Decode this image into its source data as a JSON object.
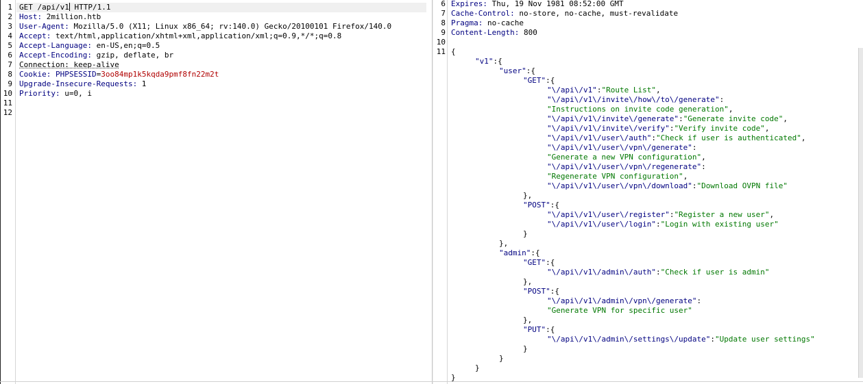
{
  "request": {
    "lines": [
      {
        "n": "1",
        "segs": [
          {
            "t": "GET /api/v1",
            "c": ""
          },
          {
            "t": " HTTP/1.1",
            "c": "",
            "caret_before": true
          }
        ]
      },
      {
        "n": "2",
        "segs": [
          {
            "t": "Host:",
            "c": "k"
          },
          {
            "t": " 2million.htb",
            "c": ""
          }
        ]
      },
      {
        "n": "3",
        "segs": [
          {
            "t": "User-Agent:",
            "c": "k"
          },
          {
            "t": " Mozilla/5.0 (X11; Linux x86_64; rv:140.0) Gecko/20100101 Firefox/140.0",
            "c": ""
          }
        ]
      },
      {
        "n": "4",
        "segs": [
          {
            "t": "Accept:",
            "c": "k"
          },
          {
            "t": " text/html,application/xhtml+xml,application/xml;q=0.9,*/*;q=0.8",
            "c": ""
          }
        ]
      },
      {
        "n": "5",
        "segs": [
          {
            "t": "Accept-Language:",
            "c": "k"
          },
          {
            "t": " en-US,en;q=0.5",
            "c": ""
          }
        ]
      },
      {
        "n": "6",
        "segs": [
          {
            "t": "Accept-Encoding:",
            "c": "k"
          },
          {
            "t": " gzip, deflate, br",
            "c": ""
          }
        ]
      },
      {
        "n": "7",
        "segs": [
          {
            "t": "Connection: keep-alive",
            "c": "underline"
          }
        ]
      },
      {
        "n": "8",
        "segs": [
          {
            "t": "Cookie:",
            "c": "k"
          },
          {
            "t": " PHPSESSID",
            "c": "ck"
          },
          {
            "t": "=",
            "c": ""
          },
          {
            "t": "3oo84mp1k5kqda9pmf8fn22m2t",
            "c": "cv"
          }
        ]
      },
      {
        "n": "9",
        "segs": [
          {
            "t": "Upgrade-Insecure-Requests:",
            "c": "k"
          },
          {
            "t": " 1",
            "c": ""
          }
        ]
      },
      {
        "n": "10",
        "segs": [
          {
            "t": "Priority:",
            "c": "k"
          },
          {
            "t": " u=0, i",
            "c": ""
          }
        ]
      },
      {
        "n": "11",
        "segs": []
      },
      {
        "n": "12",
        "segs": []
      }
    ]
  },
  "response": {
    "lines": [
      {
        "n": "6",
        "segs": [
          {
            "t": "Expires:",
            "c": "k"
          },
          {
            "t": " Thu, 19 Nov 1981 08:52:00 GMT",
            "c": ""
          }
        ]
      },
      {
        "n": "7",
        "segs": [
          {
            "t": "Cache-Control:",
            "c": "k"
          },
          {
            "t": " no-store, no-cache, must-revalidate",
            "c": ""
          }
        ]
      },
      {
        "n": "8",
        "segs": [
          {
            "t": "Pragma:",
            "c": "k"
          },
          {
            "t": " no-cache",
            "c": ""
          }
        ]
      },
      {
        "n": "9",
        "segs": [
          {
            "t": "Content-Length:",
            "c": "k"
          },
          {
            "t": " 800",
            "c": ""
          }
        ]
      },
      {
        "n": "10",
        "segs": []
      },
      {
        "n": "11",
        "segs": [
          {
            "t": "{",
            "c": ""
          }
        ]
      },
      {
        "n": "",
        "indent": 5,
        "segs": [
          {
            "t": "\"v1\"",
            "c": "js"
          },
          {
            "t": ":{",
            "c": ""
          }
        ]
      },
      {
        "n": "",
        "indent": 10,
        "segs": [
          {
            "t": "\"user\"",
            "c": "js"
          },
          {
            "t": ":{",
            "c": ""
          }
        ]
      },
      {
        "n": "",
        "indent": 15,
        "segs": [
          {
            "t": "\"GET\"",
            "c": "js"
          },
          {
            "t": ":{",
            "c": ""
          }
        ]
      },
      {
        "n": "",
        "indent": 20,
        "segs": [
          {
            "t": "\"\\/api\\/v1\"",
            "c": "js"
          },
          {
            "t": ":",
            "c": ""
          },
          {
            "t": "\"Route List\"",
            "c": "jv"
          },
          {
            "t": ",",
            "c": ""
          }
        ]
      },
      {
        "n": "",
        "indent": 20,
        "segs": [
          {
            "t": "\"\\/api\\/v1\\/invite\\/how\\/to\\/generate\"",
            "c": "js"
          },
          {
            "t": ":",
            "c": ""
          }
        ]
      },
      {
        "n": "",
        "indent": 20,
        "segs": [
          {
            "t": "\"Instructions on invite code generation\"",
            "c": "jv"
          },
          {
            "t": ",",
            "c": ""
          }
        ]
      },
      {
        "n": "",
        "indent": 20,
        "segs": [
          {
            "t": "\"\\/api\\/v1\\/invite\\/generate\"",
            "c": "js"
          },
          {
            "t": ":",
            "c": ""
          },
          {
            "t": "\"Generate invite code\"",
            "c": "jv"
          },
          {
            "t": ",",
            "c": ""
          }
        ]
      },
      {
        "n": "",
        "indent": 20,
        "segs": [
          {
            "t": "\"\\/api\\/v1\\/invite\\/verify\"",
            "c": "js"
          },
          {
            "t": ":",
            "c": ""
          },
          {
            "t": "\"Verify invite code\"",
            "c": "jv"
          },
          {
            "t": ",",
            "c": ""
          }
        ]
      },
      {
        "n": "",
        "indent": 20,
        "segs": [
          {
            "t": "\"\\/api\\/v1\\/user\\/auth\"",
            "c": "js"
          },
          {
            "t": ":",
            "c": ""
          },
          {
            "t": "\"Check if user is authenticated\"",
            "c": "jv"
          },
          {
            "t": ",",
            "c": ""
          }
        ]
      },
      {
        "n": "",
        "indent": 20,
        "segs": [
          {
            "t": "\"\\/api\\/v1\\/user\\/vpn\\/generate\"",
            "c": "js"
          },
          {
            "t": ":",
            "c": ""
          }
        ]
      },
      {
        "n": "",
        "indent": 20,
        "segs": [
          {
            "t": "\"Generate a new VPN configuration\"",
            "c": "jv"
          },
          {
            "t": ",",
            "c": ""
          }
        ]
      },
      {
        "n": "",
        "indent": 20,
        "segs": [
          {
            "t": "\"\\/api\\/v1\\/user\\/vpn\\/regenerate\"",
            "c": "js"
          },
          {
            "t": ":",
            "c": ""
          }
        ]
      },
      {
        "n": "",
        "indent": 20,
        "segs": [
          {
            "t": "\"Regenerate VPN configuration\"",
            "c": "jv"
          },
          {
            "t": ",",
            "c": ""
          }
        ]
      },
      {
        "n": "",
        "indent": 20,
        "segs": [
          {
            "t": "\"\\/api\\/v1\\/user\\/vpn\\/download\"",
            "c": "js"
          },
          {
            "t": ":",
            "c": ""
          },
          {
            "t": "\"Download OVPN file\"",
            "c": "jv"
          }
        ]
      },
      {
        "n": "",
        "indent": 15,
        "segs": [
          {
            "t": "},",
            "c": ""
          }
        ]
      },
      {
        "n": "",
        "indent": 15,
        "segs": [
          {
            "t": "\"POST\"",
            "c": "js"
          },
          {
            "t": ":{",
            "c": ""
          }
        ]
      },
      {
        "n": "",
        "indent": 20,
        "segs": [
          {
            "t": "\"\\/api\\/v1\\/user\\/register\"",
            "c": "js"
          },
          {
            "t": ":",
            "c": ""
          },
          {
            "t": "\"Register a new user\"",
            "c": "jv"
          },
          {
            "t": ",",
            "c": ""
          }
        ]
      },
      {
        "n": "",
        "indent": 20,
        "segs": [
          {
            "t": "\"\\/api\\/v1\\/user\\/login\"",
            "c": "js"
          },
          {
            "t": ":",
            "c": ""
          },
          {
            "t": "\"Login with existing user\"",
            "c": "jv"
          }
        ]
      },
      {
        "n": "",
        "indent": 15,
        "segs": [
          {
            "t": "}",
            "c": ""
          }
        ]
      },
      {
        "n": "",
        "indent": 10,
        "segs": [
          {
            "t": "},",
            "c": ""
          }
        ]
      },
      {
        "n": "",
        "indent": 10,
        "segs": [
          {
            "t": "\"admin\"",
            "c": "js"
          },
          {
            "t": ":{",
            "c": ""
          }
        ]
      },
      {
        "n": "",
        "indent": 15,
        "segs": [
          {
            "t": "\"GET\"",
            "c": "js"
          },
          {
            "t": ":{",
            "c": ""
          }
        ]
      },
      {
        "n": "",
        "indent": 20,
        "segs": [
          {
            "t": "\"\\/api\\/v1\\/admin\\/auth\"",
            "c": "js"
          },
          {
            "t": ":",
            "c": ""
          },
          {
            "t": "\"Check if user is admin\"",
            "c": "jv"
          }
        ]
      },
      {
        "n": "",
        "indent": 15,
        "segs": [
          {
            "t": "},",
            "c": ""
          }
        ]
      },
      {
        "n": "",
        "indent": 15,
        "segs": [
          {
            "t": "\"POST\"",
            "c": "js"
          },
          {
            "t": ":{",
            "c": ""
          }
        ]
      },
      {
        "n": "",
        "indent": 20,
        "segs": [
          {
            "t": "\"\\/api\\/v1\\/admin\\/vpn\\/generate\"",
            "c": "js"
          },
          {
            "t": ":",
            "c": ""
          }
        ]
      },
      {
        "n": "",
        "indent": 20,
        "segs": [
          {
            "t": "\"Generate VPN for specific user\"",
            "c": "jv"
          }
        ]
      },
      {
        "n": "",
        "indent": 15,
        "segs": [
          {
            "t": "},",
            "c": ""
          }
        ]
      },
      {
        "n": "",
        "indent": 15,
        "segs": [
          {
            "t": "\"PUT\"",
            "c": "js"
          },
          {
            "t": ":{",
            "c": ""
          }
        ]
      },
      {
        "n": "",
        "indent": 20,
        "segs": [
          {
            "t": "\"\\/api\\/v1\\/admin\\/settings\\/update\"",
            "c": "js"
          },
          {
            "t": ":",
            "c": ""
          },
          {
            "t": "\"Update user settings\"",
            "c": "jv"
          }
        ]
      },
      {
        "n": "",
        "indent": 15,
        "segs": [
          {
            "t": "}",
            "c": ""
          }
        ]
      },
      {
        "n": "",
        "indent": 10,
        "segs": [
          {
            "t": "}",
            "c": ""
          }
        ]
      },
      {
        "n": "",
        "indent": 5,
        "segs": [
          {
            "t": "}",
            "c": ""
          }
        ]
      },
      {
        "n": "",
        "segs": [
          {
            "t": "}",
            "c": ""
          }
        ]
      }
    ]
  },
  "colors": {
    "header_key": "#000080",
    "cookie_value": "#b00000",
    "json_key": "#000080",
    "json_value": "#007700"
  }
}
